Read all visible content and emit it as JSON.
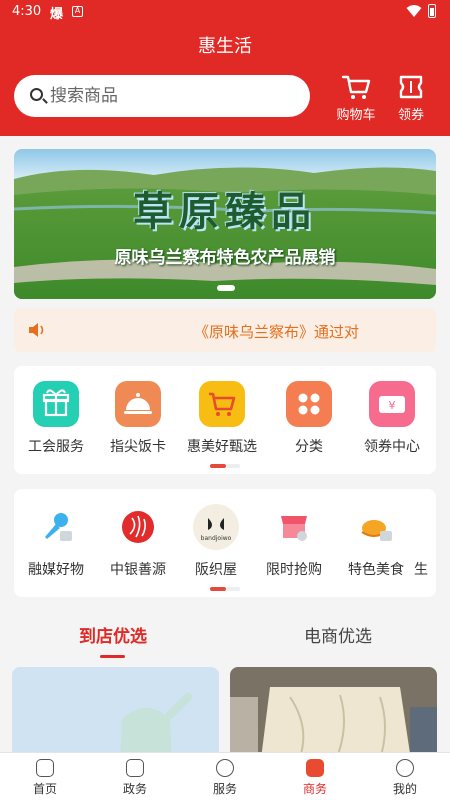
{
  "status": {
    "time": "4:30",
    "icon_a": "爆",
    "icon_b": "A"
  },
  "header": {
    "title": "惠生活",
    "search_placeholder": "搜索商品",
    "cart_label": "购物车",
    "coupon_label": "领券"
  },
  "banner": {
    "title": "草原臻品",
    "subtitle": "原味乌兰察布特色农产品展销"
  },
  "notice": {
    "text": "《原味乌兰察布》通过对"
  },
  "grid1": [
    {
      "label": "工会服务",
      "icon": "gift-icon",
      "color": "#25cfb3"
    },
    {
      "label": "指尖饭卡",
      "icon": "dish-icon",
      "color": "#f08a55"
    },
    {
      "label": "惠美好甄选",
      "icon": "cart-icon",
      "color": "#f7bd12"
    },
    {
      "label": "分类",
      "icon": "category-icon",
      "color": "#f47d52"
    },
    {
      "label": "领券中心",
      "icon": "ticket-icon",
      "color": "#f76b8f"
    }
  ],
  "grid2": [
    {
      "label": "融媒好物",
      "icon": "microphone-icon"
    },
    {
      "label": "中银善源",
      "icon": "bank-of-china-icon"
    },
    {
      "label": "阪织屋",
      "icon": "bandjoiwo-logo",
      "logo_text": "bandjoiwo"
    },
    {
      "label": "限时抢购",
      "icon": "flash-sale-icon"
    },
    {
      "label": "特色美食",
      "icon": "food-icon"
    },
    {
      "label": "生"
    }
  ],
  "tabs": [
    {
      "label": "到店优选",
      "active": true
    },
    {
      "label": "电商优选",
      "active": false
    }
  ],
  "bottom_nav": [
    {
      "label": "首页",
      "icon": "home-icon"
    },
    {
      "label": "政务",
      "icon": "government-icon"
    },
    {
      "label": "服务",
      "icon": "service-icon"
    },
    {
      "label": "商务",
      "icon": "business-icon",
      "active": true
    },
    {
      "label": "我的",
      "icon": "profile-icon"
    }
  ],
  "colors": {
    "brand": "#e12a25",
    "notice_text": "#e4701e",
    "notice_bg": "#fbeee4"
  }
}
